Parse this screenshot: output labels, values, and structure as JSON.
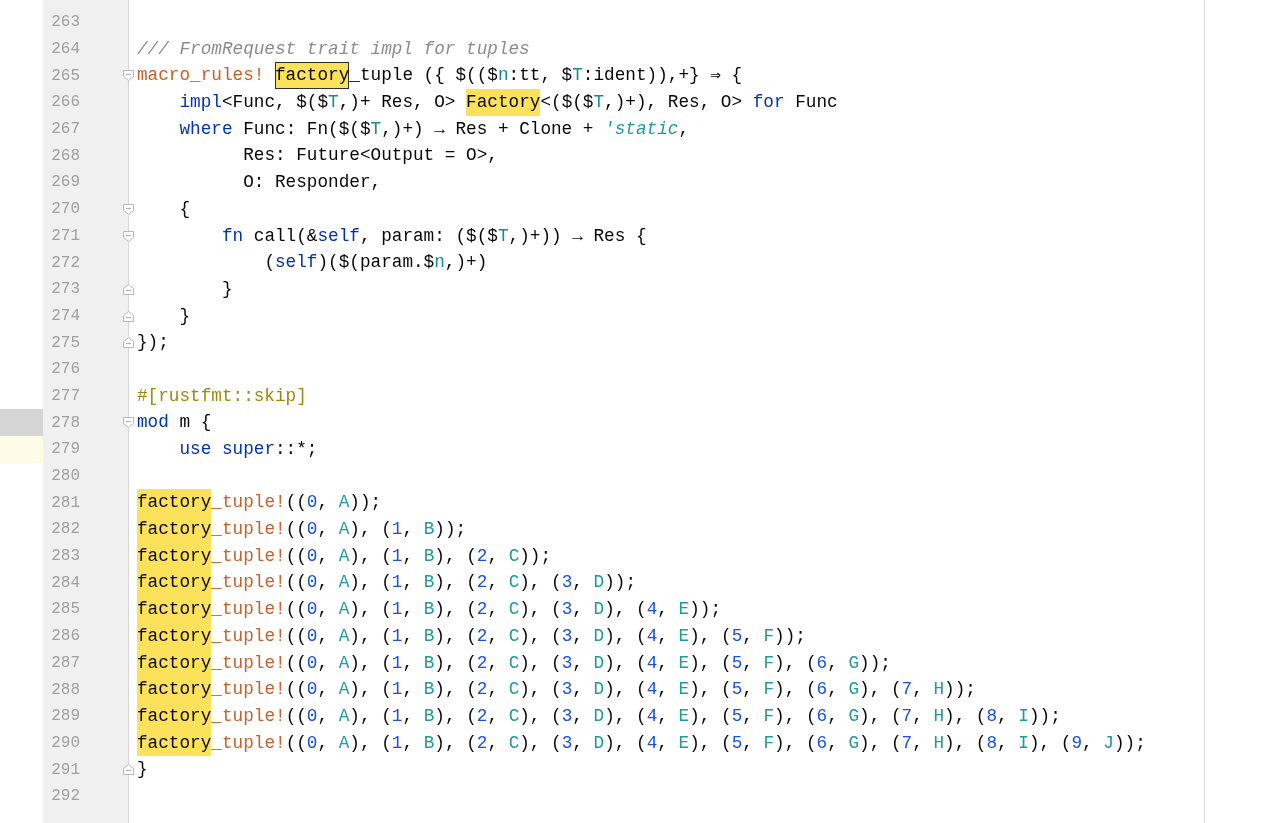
{
  "editor": {
    "lines": [
      {
        "number": "263",
        "current": false,
        "hovered": false
      },
      {
        "number": "264",
        "current": false,
        "hovered": false,
        "tokens": [
          {
            "text": "/// FromRequest trait impl for tuples",
            "kind": "comment"
          }
        ]
      },
      {
        "number": "265",
        "current": false,
        "hovered": false,
        "kind": "fold_start",
        "tokens": [
          {
            "text": "macro_rules! ",
            "kind": "macro"
          },
          {
            "text": "factory",
            "kind": "current"
          },
          {
            "text": "_tuple ({ $(($",
            "kind": "plain"
          },
          {
            "text": "n",
            "kind": "meta"
          },
          {
            "text": ":tt, $",
            "kind": "plain"
          },
          {
            "text": "T",
            "kind": "meta"
          },
          {
            "text": ":ident)),+} ⇒ {",
            "kind": "plain"
          }
        ]
      },
      {
        "number": "266",
        "current": false,
        "hovered": false,
        "tokens": [
          {
            "text": "    impl",
            "kind": "keyword"
          },
          {
            "text": "<Func, $($",
            "kind": "plain"
          },
          {
            "text": "T",
            "kind": "meta"
          },
          {
            "text": ",)+ Res, O> ",
            "kind": "plain"
          },
          {
            "text": "Factory",
            "kind": "match"
          },
          {
            "text": "<($($",
            "kind": "plain"
          },
          {
            "text": "T",
            "kind": "meta"
          },
          {
            "text": ",)+), Res, O> ",
            "kind": "plain"
          },
          {
            "text": "for",
            "kind": "keyword"
          },
          {
            "text": " Func",
            "kind": "plain"
          }
        ]
      },
      {
        "number": "267",
        "current": false,
        "hovered": false,
        "tokens": [
          {
            "text": "    where",
            "kind": "keyword"
          },
          {
            "text": " Func: Fn($($",
            "kind": "plain"
          },
          {
            "text": "T",
            "kind": "meta"
          },
          {
            "text": ",)+) → Res + Clone + ",
            "kind": "plain"
          },
          {
            "text": "'static",
            "kind": "lifetime"
          },
          {
            "text": ",",
            "kind": "plain"
          }
        ]
      },
      {
        "number": "268",
        "current": false,
        "hovered": false,
        "tokens": [
          {
            "text": "          Res: Future<Output = O>,",
            "kind": "plain"
          }
        ]
      },
      {
        "number": "269",
        "current": false,
        "hovered": false,
        "tokens": [
          {
            "text": "          O: Responder,",
            "kind": "plain"
          }
        ]
      },
      {
        "number": "270",
        "current": false,
        "hovered": false,
        "kind": "fold_start",
        "tokens": [
          {
            "text": "    {",
            "kind": "plain"
          }
        ]
      },
      {
        "number": "271",
        "current": false,
        "hovered": false,
        "kind": "fold_start",
        "tokens": [
          {
            "text": "        fn",
            "kind": "keyword"
          },
          {
            "text": " call(&",
            "kind": "plain"
          },
          {
            "text": "self",
            "kind": "keyword"
          },
          {
            "text": ", param: ($($",
            "kind": "plain"
          },
          {
            "text": "T",
            "kind": "meta"
          },
          {
            "text": ",)+)) → Res {",
            "kind": "plain"
          }
        ]
      },
      {
        "number": "272",
        "current": false,
        "hovered": false,
        "tokens": [
          {
            "text": "            (",
            "kind": "plain"
          },
          {
            "text": "self",
            "kind": "keyword"
          },
          {
            "text": ")($(param.$",
            "kind": "plain"
          },
          {
            "text": "n",
            "kind": "meta"
          },
          {
            "text": ",)+)",
            "kind": "plain"
          }
        ]
      },
      {
        "number": "273",
        "current": false,
        "hovered": false,
        "kind": "fold_end",
        "tokens": [
          {
            "text": "        }",
            "kind": "plain"
          }
        ]
      },
      {
        "number": "274",
        "current": false,
        "hovered": false,
        "kind": "fold_end",
        "tokens": [
          {
            "text": "    }",
            "kind": "plain"
          }
        ]
      },
      {
        "number": "275",
        "current": false,
        "hovered": false,
        "kind": "fold_end",
        "tokens": [
          {
            "text": "});",
            "kind": "plain"
          }
        ]
      },
      {
        "number": "276",
        "current": false,
        "hovered": false
      },
      {
        "number": "277",
        "current": false,
        "hovered": false,
        "tokens": [
          {
            "text": "#[rustfmt::skip]",
            "kind": "attribute"
          }
        ]
      },
      {
        "number": "278",
        "current": false,
        "hovered": true,
        "kind": "fold_start",
        "tokens": [
          {
            "text": "mod",
            "kind": "keyword"
          },
          {
            "text": " m {",
            "kind": "plain"
          }
        ]
      },
      {
        "number": "279",
        "current": true,
        "hovered": false,
        "tokens": [
          {
            "text": "    use super",
            "kind": "keyword"
          },
          {
            "text": "::*;",
            "kind": "plain"
          }
        ]
      },
      {
        "number": "280",
        "current": false,
        "hovered": false
      },
      {
        "number": "281",
        "current": false,
        "hovered": false,
        "tokens": [
          {
            "text": "factory",
            "kind": "match"
          },
          {
            "text": "_tuple!",
            "kind": "macro"
          },
          {
            "text": "((",
            "kind": "plain"
          },
          {
            "text": "0",
            "kind": "number"
          },
          {
            "text": ", ",
            "kind": "plain"
          },
          {
            "text": "A",
            "kind": "type"
          },
          {
            "text": "));",
            "kind": "plain"
          }
        ]
      },
      {
        "number": "282",
        "current": false,
        "hovered": false,
        "tokens": [
          {
            "text": "factory",
            "kind": "match"
          },
          {
            "text": "_tuple!",
            "kind": "macro"
          },
          {
            "text": "((",
            "kind": "plain"
          },
          {
            "text": "0",
            "kind": "number"
          },
          {
            "text": ", ",
            "kind": "plain"
          },
          {
            "text": "A",
            "kind": "type"
          },
          {
            "text": "), (",
            "kind": "plain"
          },
          {
            "text": "1",
            "kind": "number"
          },
          {
            "text": ", ",
            "kind": "plain"
          },
          {
            "text": "B",
            "kind": "type"
          },
          {
            "text": "));",
            "kind": "plain"
          }
        ]
      },
      {
        "number": "283",
        "current": false,
        "hovered": false,
        "tokens": [
          {
            "text": "factory",
            "kind": "match"
          },
          {
            "text": "_tuple!",
            "kind": "macro"
          },
          {
            "text": "((",
            "kind": "plain"
          },
          {
            "text": "0",
            "kind": "number"
          },
          {
            "text": ", ",
            "kind": "plain"
          },
          {
            "text": "A",
            "kind": "type"
          },
          {
            "text": "), (",
            "kind": "plain"
          },
          {
            "text": "1",
            "kind": "number"
          },
          {
            "text": ", ",
            "kind": "plain"
          },
          {
            "text": "B",
            "kind": "type"
          },
          {
            "text": "), (",
            "kind": "plain"
          },
          {
            "text": "2",
            "kind": "number"
          },
          {
            "text": ", ",
            "kind": "plain"
          },
          {
            "text": "C",
            "kind": "type"
          },
          {
            "text": "));",
            "kind": "plain"
          }
        ]
      },
      {
        "number": "284",
        "current": false,
        "hovered": false,
        "tokens": [
          {
            "text": "factory",
            "kind": "match"
          },
          {
            "text": "_tuple!",
            "kind": "macro"
          },
          {
            "text": "((",
            "kind": "plain"
          },
          {
            "text": "0",
            "kind": "number"
          },
          {
            "text": ", ",
            "kind": "plain"
          },
          {
            "text": "A",
            "kind": "type"
          },
          {
            "text": "), (",
            "kind": "plain"
          },
          {
            "text": "1",
            "kind": "number"
          },
          {
            "text": ", ",
            "kind": "plain"
          },
          {
            "text": "B",
            "kind": "type"
          },
          {
            "text": "), (",
            "kind": "plain"
          },
          {
            "text": "2",
            "kind": "number"
          },
          {
            "text": ", ",
            "kind": "plain"
          },
          {
            "text": "C",
            "kind": "type"
          },
          {
            "text": "), (",
            "kind": "plain"
          },
          {
            "text": "3",
            "kind": "number"
          },
          {
            "text": ", ",
            "kind": "plain"
          },
          {
            "text": "D",
            "kind": "type"
          },
          {
            "text": "));",
            "kind": "plain"
          }
        ]
      },
      {
        "number": "285",
        "current": false,
        "hovered": false,
        "tokens": [
          {
            "text": "factory",
            "kind": "match"
          },
          {
            "text": "_tuple!",
            "kind": "macro"
          },
          {
            "text": "((",
            "kind": "plain"
          },
          {
            "text": "0",
            "kind": "number"
          },
          {
            "text": ", ",
            "kind": "plain"
          },
          {
            "text": "A",
            "kind": "type"
          },
          {
            "text": "), (",
            "kind": "plain"
          },
          {
            "text": "1",
            "kind": "number"
          },
          {
            "text": ", ",
            "kind": "plain"
          },
          {
            "text": "B",
            "kind": "type"
          },
          {
            "text": "), (",
            "kind": "plain"
          },
          {
            "text": "2",
            "kind": "number"
          },
          {
            "text": ", ",
            "kind": "plain"
          },
          {
            "text": "C",
            "kind": "type"
          },
          {
            "text": "), (",
            "kind": "plain"
          },
          {
            "text": "3",
            "kind": "number"
          },
          {
            "text": ", ",
            "kind": "plain"
          },
          {
            "text": "D",
            "kind": "type"
          },
          {
            "text": "), (",
            "kind": "plain"
          },
          {
            "text": "4",
            "kind": "number"
          },
          {
            "text": ", ",
            "kind": "plain"
          },
          {
            "text": "E",
            "kind": "type"
          },
          {
            "text": "));",
            "kind": "plain"
          }
        ]
      },
      {
        "number": "286",
        "current": false,
        "hovered": false,
        "tokens": [
          {
            "text": "factory",
            "kind": "match"
          },
          {
            "text": "_tuple!",
            "kind": "macro"
          },
          {
            "text": "((",
            "kind": "plain"
          },
          {
            "text": "0",
            "kind": "number"
          },
          {
            "text": ", ",
            "kind": "plain"
          },
          {
            "text": "A",
            "kind": "type"
          },
          {
            "text": "), (",
            "kind": "plain"
          },
          {
            "text": "1",
            "kind": "number"
          },
          {
            "text": ", ",
            "kind": "plain"
          },
          {
            "text": "B",
            "kind": "type"
          },
          {
            "text": "), (",
            "kind": "plain"
          },
          {
            "text": "2",
            "kind": "number"
          },
          {
            "text": ", ",
            "kind": "plain"
          },
          {
            "text": "C",
            "kind": "type"
          },
          {
            "text": "), (",
            "kind": "plain"
          },
          {
            "text": "3",
            "kind": "number"
          },
          {
            "text": ", ",
            "kind": "plain"
          },
          {
            "text": "D",
            "kind": "type"
          },
          {
            "text": "), (",
            "kind": "plain"
          },
          {
            "text": "4",
            "kind": "number"
          },
          {
            "text": ", ",
            "kind": "plain"
          },
          {
            "text": "E",
            "kind": "type"
          },
          {
            "text": "), (",
            "kind": "plain"
          },
          {
            "text": "5",
            "kind": "number"
          },
          {
            "text": ", ",
            "kind": "plain"
          },
          {
            "text": "F",
            "kind": "type"
          },
          {
            "text": "));",
            "kind": "plain"
          }
        ]
      },
      {
        "number": "287",
        "current": false,
        "hovered": false,
        "tokens": [
          {
            "text": "factory",
            "kind": "match"
          },
          {
            "text": "_tuple!",
            "kind": "macro"
          },
          {
            "text": "((",
            "kind": "plain"
          },
          {
            "text": "0",
            "kind": "number"
          },
          {
            "text": ", ",
            "kind": "plain"
          },
          {
            "text": "A",
            "kind": "type"
          },
          {
            "text": "), (",
            "kind": "plain"
          },
          {
            "text": "1",
            "kind": "number"
          },
          {
            "text": ", ",
            "kind": "plain"
          },
          {
            "text": "B",
            "kind": "type"
          },
          {
            "text": "), (",
            "kind": "plain"
          },
          {
            "text": "2",
            "kind": "number"
          },
          {
            "text": ", ",
            "kind": "plain"
          },
          {
            "text": "C",
            "kind": "type"
          },
          {
            "text": "), (",
            "kind": "plain"
          },
          {
            "text": "3",
            "kind": "number"
          },
          {
            "text": ", ",
            "kind": "plain"
          },
          {
            "text": "D",
            "kind": "type"
          },
          {
            "text": "), (",
            "kind": "plain"
          },
          {
            "text": "4",
            "kind": "number"
          },
          {
            "text": ", ",
            "kind": "plain"
          },
          {
            "text": "E",
            "kind": "type"
          },
          {
            "text": "), (",
            "kind": "plain"
          },
          {
            "text": "5",
            "kind": "number"
          },
          {
            "text": ", ",
            "kind": "plain"
          },
          {
            "text": "F",
            "kind": "type"
          },
          {
            "text": "), (",
            "kind": "plain"
          },
          {
            "text": "6",
            "kind": "number"
          },
          {
            "text": ", ",
            "kind": "plain"
          },
          {
            "text": "G",
            "kind": "type"
          },
          {
            "text": "));",
            "kind": "plain"
          }
        ]
      },
      {
        "number": "288",
        "current": false,
        "hovered": false,
        "tokens": [
          {
            "text": "factory",
            "kind": "match"
          },
          {
            "text": "_tuple!",
            "kind": "macro"
          },
          {
            "text": "((",
            "kind": "plain"
          },
          {
            "text": "0",
            "kind": "number"
          },
          {
            "text": ", ",
            "kind": "plain"
          },
          {
            "text": "A",
            "kind": "type"
          },
          {
            "text": "), (",
            "kind": "plain"
          },
          {
            "text": "1",
            "kind": "number"
          },
          {
            "text": ", ",
            "kind": "plain"
          },
          {
            "text": "B",
            "kind": "type"
          },
          {
            "text": "), (",
            "kind": "plain"
          },
          {
            "text": "2",
            "kind": "number"
          },
          {
            "text": ", ",
            "kind": "plain"
          },
          {
            "text": "C",
            "kind": "type"
          },
          {
            "text": "), (",
            "kind": "plain"
          },
          {
            "text": "3",
            "kind": "number"
          },
          {
            "text": ", ",
            "kind": "plain"
          },
          {
            "text": "D",
            "kind": "type"
          },
          {
            "text": "), (",
            "kind": "plain"
          },
          {
            "text": "4",
            "kind": "number"
          },
          {
            "text": ", ",
            "kind": "plain"
          },
          {
            "text": "E",
            "kind": "type"
          },
          {
            "text": "), (",
            "kind": "plain"
          },
          {
            "text": "5",
            "kind": "number"
          },
          {
            "text": ", ",
            "kind": "plain"
          },
          {
            "text": "F",
            "kind": "type"
          },
          {
            "text": "), (",
            "kind": "plain"
          },
          {
            "text": "6",
            "kind": "number"
          },
          {
            "text": ", ",
            "kind": "plain"
          },
          {
            "text": "G",
            "kind": "type"
          },
          {
            "text": "), (",
            "kind": "plain"
          },
          {
            "text": "7",
            "kind": "number"
          },
          {
            "text": ", ",
            "kind": "plain"
          },
          {
            "text": "H",
            "kind": "type"
          },
          {
            "text": "));",
            "kind": "plain"
          }
        ]
      },
      {
        "number": "289",
        "current": false,
        "hovered": false,
        "tokens": [
          {
            "text": "factory",
            "kind": "match"
          },
          {
            "text": "_tuple!",
            "kind": "macro"
          },
          {
            "text": "((",
            "kind": "plain"
          },
          {
            "text": "0",
            "kind": "number"
          },
          {
            "text": ", ",
            "kind": "plain"
          },
          {
            "text": "A",
            "kind": "type"
          },
          {
            "text": "), (",
            "kind": "plain"
          },
          {
            "text": "1",
            "kind": "number"
          },
          {
            "text": ", ",
            "kind": "plain"
          },
          {
            "text": "B",
            "kind": "type"
          },
          {
            "text": "), (",
            "kind": "plain"
          },
          {
            "text": "2",
            "kind": "number"
          },
          {
            "text": ", ",
            "kind": "plain"
          },
          {
            "text": "C",
            "kind": "type"
          },
          {
            "text": "), (",
            "kind": "plain"
          },
          {
            "text": "3",
            "kind": "number"
          },
          {
            "text": ", ",
            "kind": "plain"
          },
          {
            "text": "D",
            "kind": "type"
          },
          {
            "text": "), (",
            "kind": "plain"
          },
          {
            "text": "4",
            "kind": "number"
          },
          {
            "text": ", ",
            "kind": "plain"
          },
          {
            "text": "E",
            "kind": "type"
          },
          {
            "text": "), (",
            "kind": "plain"
          },
          {
            "text": "5",
            "kind": "number"
          },
          {
            "text": ", ",
            "kind": "plain"
          },
          {
            "text": "F",
            "kind": "type"
          },
          {
            "text": "), (",
            "kind": "plain"
          },
          {
            "text": "6",
            "kind": "number"
          },
          {
            "text": ", ",
            "kind": "plain"
          },
          {
            "text": "G",
            "kind": "type"
          },
          {
            "text": "), (",
            "kind": "plain"
          },
          {
            "text": "7",
            "kind": "number"
          },
          {
            "text": ", ",
            "kind": "plain"
          },
          {
            "text": "H",
            "kind": "type"
          },
          {
            "text": "), (",
            "kind": "plain"
          },
          {
            "text": "8",
            "kind": "number"
          },
          {
            "text": ", ",
            "kind": "plain"
          },
          {
            "text": "I",
            "kind": "type"
          },
          {
            "text": "));",
            "kind": "plain"
          }
        ]
      },
      {
        "number": "290",
        "current": false,
        "hovered": false,
        "tokens": [
          {
            "text": "factory",
            "kind": "match"
          },
          {
            "text": "_tuple!",
            "kind": "macro"
          },
          {
            "text": "((",
            "kind": "plain"
          },
          {
            "text": "0",
            "kind": "number"
          },
          {
            "text": ", ",
            "kind": "plain"
          },
          {
            "text": "A",
            "kind": "type"
          },
          {
            "text": "), (",
            "kind": "plain"
          },
          {
            "text": "1",
            "kind": "number"
          },
          {
            "text": ", ",
            "kind": "plain"
          },
          {
            "text": "B",
            "kind": "type"
          },
          {
            "text": "), (",
            "kind": "plain"
          },
          {
            "text": "2",
            "kind": "number"
          },
          {
            "text": ", ",
            "kind": "plain"
          },
          {
            "text": "C",
            "kind": "type"
          },
          {
            "text": "), (",
            "kind": "plain"
          },
          {
            "text": "3",
            "kind": "number"
          },
          {
            "text": ", ",
            "kind": "plain"
          },
          {
            "text": "D",
            "kind": "type"
          },
          {
            "text": "), (",
            "kind": "plain"
          },
          {
            "text": "4",
            "kind": "number"
          },
          {
            "text": ", ",
            "kind": "plain"
          },
          {
            "text": "E",
            "kind": "type"
          },
          {
            "text": "), (",
            "kind": "plain"
          },
          {
            "text": "5",
            "kind": "number"
          },
          {
            "text": ", ",
            "kind": "plain"
          },
          {
            "text": "F",
            "kind": "type"
          },
          {
            "text": "), (",
            "kind": "plain"
          },
          {
            "text": "6",
            "kind": "number"
          },
          {
            "text": ", ",
            "kind": "plain"
          },
          {
            "text": "G",
            "kind": "type"
          },
          {
            "text": "), (",
            "kind": "plain"
          },
          {
            "text": "7",
            "kind": "number"
          },
          {
            "text": ", ",
            "kind": "plain"
          },
          {
            "text": "H",
            "kind": "type"
          },
          {
            "text": "), (",
            "kind": "plain"
          },
          {
            "text": "8",
            "kind": "number"
          },
          {
            "text": ", ",
            "kind": "plain"
          },
          {
            "text": "I",
            "kind": "type"
          },
          {
            "text": "), (",
            "kind": "plain"
          },
          {
            "text": "9",
            "kind": "number"
          },
          {
            "text": ", ",
            "kind": "plain"
          },
          {
            "text": "J",
            "kind": "type"
          },
          {
            "text": "));",
            "kind": "plain"
          }
        ]
      },
      {
        "number": "291",
        "current": false,
        "hovered": false,
        "kind": "fold_end",
        "tokens": [
          {
            "text": "}",
            "kind": "plain"
          }
        ]
      },
      {
        "number": "292",
        "current": false,
        "hovered": false
      }
    ]
  }
}
